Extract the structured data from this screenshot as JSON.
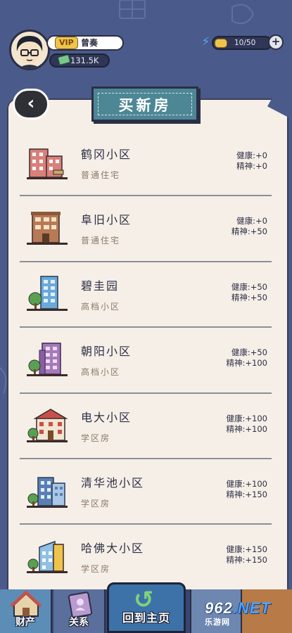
{
  "player": {
    "vip_label": "VIP",
    "name": "曾奏",
    "money": "131.5K"
  },
  "energy": {
    "value": "10/50",
    "fraction": 0.2,
    "plus": "+"
  },
  "panel": {
    "back_glyph": "‹",
    "title": "买新房"
  },
  "houses": [
    {
      "name": "鹤冈小区",
      "type": "普通住宅",
      "health": "健康:+0",
      "spirit": "精神:+0",
      "icon": "red-apartment-building-icon"
    },
    {
      "name": "阜旧小区",
      "type": "普通住宅",
      "health": "健康:+0",
      "spirit": "精神:+50",
      "icon": "brown-old-building-icon"
    },
    {
      "name": "碧圭园",
      "type": "高档小区",
      "health": "健康:+50",
      "spirit": "精神:+50",
      "icon": "blue-tower-icon"
    },
    {
      "name": "朝阳小区",
      "type": "高档小区",
      "health": "健康:+50",
      "spirit": "精神:+100",
      "icon": "purple-tower-icon"
    },
    {
      "name": "电大小区",
      "type": "学区房",
      "health": "健康:+100",
      "spirit": "精神:+100",
      "icon": "school-building-icon"
    },
    {
      "name": "清华池小区",
      "type": "学区房",
      "health": "健康:+100",
      "spirit": "精神:+150",
      "icon": "blue-apartment-icon"
    },
    {
      "name": "哈佛大小区",
      "type": "学区房",
      "health": "健康:+150",
      "spirit": "精神:+150",
      "icon": "modern-building-icon"
    }
  ],
  "nav": {
    "property": "财产",
    "relations": "关系",
    "home": "回到主页"
  },
  "watermark": {
    "logo_a": "962",
    "logo_b": ".NET",
    "sub": "乐游网"
  }
}
